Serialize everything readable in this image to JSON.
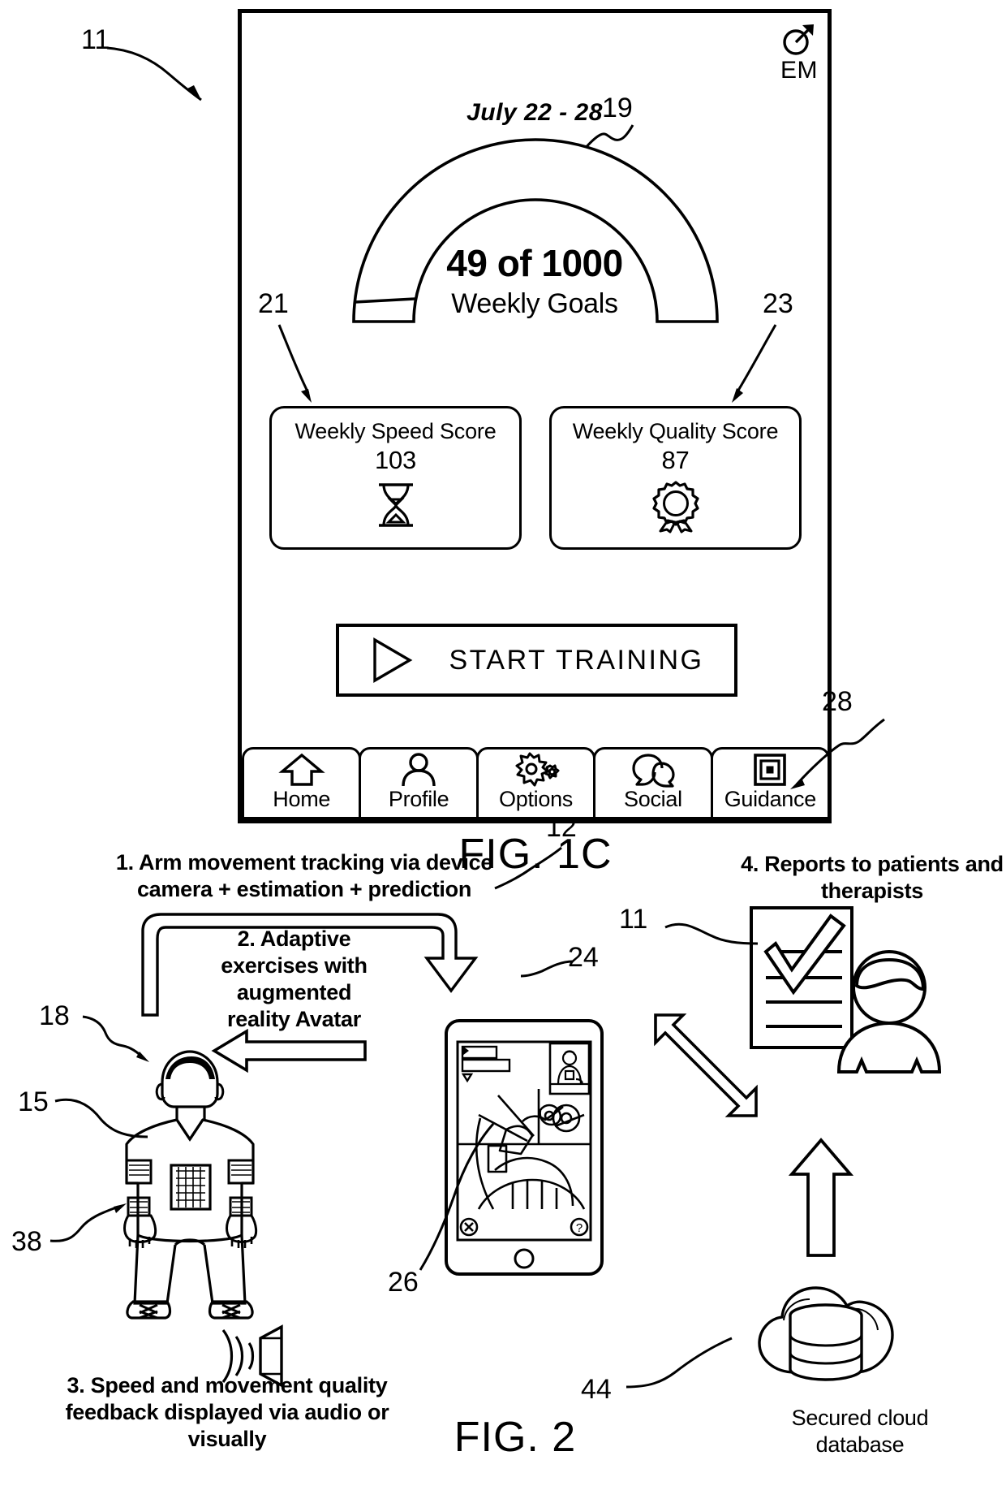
{
  "figures": {
    "fig1c_caption": "FIG. 1C",
    "fig2_caption": "FIG. 2"
  },
  "app_screen": {
    "badge": {
      "icon": "target-arrow-icon",
      "label": "EM"
    },
    "date_range": "July 22 - 28",
    "goal_gauge": {
      "icon": "semicircular-progress-arc",
      "center_primary": "49 of 1000",
      "center_secondary": "Weekly Goals",
      "current": 49,
      "target": 1000,
      "percent": 4.9
    },
    "cards": [
      {
        "title": "Weekly Speed Score",
        "value": "103",
        "icon": "hourglass-icon"
      },
      {
        "title": "Weekly Quality Score",
        "value": "87",
        "icon": "award-ribbon-icon"
      }
    ],
    "start_button": {
      "icon": "play-triangle-icon",
      "label": "START TRAINING"
    },
    "bottom_nav": [
      {
        "label": "Home",
        "icon": "home-arrow-icon"
      },
      {
        "label": "Profile",
        "icon": "person-icon"
      },
      {
        "label": "Options",
        "icon": "gears-icon"
      },
      {
        "label": "Social",
        "icon": "speech-bubbles-icon"
      },
      {
        "label": "Guidance",
        "icon": "nested-squares-icon"
      }
    ]
  },
  "system_diagram": {
    "steps": {
      "step1": "1. Arm movement tracking via device camera + estimation + prediction",
      "step2": "2. Adaptive exercises with augmented reality Avatar",
      "step3": "3. Speed and movement quality feedback displayed via audio or visually",
      "step4": "4. Reports to patients and therapists"
    },
    "cloud_label": "Secured cloud database",
    "icons": {
      "patient": "seated-patient-icon",
      "tablet": "tablet-device-icon",
      "report": "report-document-icon",
      "therapist": "therapist-person-icon",
      "cloud_db": "cloud-database-icon",
      "speaker": "speaker-audio-icon",
      "avatar_scene": "ar-avatar-scene-icon"
    }
  },
  "reference_numerals": {
    "n11_fig1c": "11",
    "n19": "19",
    "n21": "21",
    "n23": "23",
    "n28": "28",
    "n12": "12",
    "n24": "24",
    "n26": "26",
    "n18": "18",
    "n15": "15",
    "n38": "38",
    "n11_fig2": "11",
    "n44": "44"
  },
  "colors": {
    "ink": "#000000",
    "paper": "#ffffff"
  }
}
